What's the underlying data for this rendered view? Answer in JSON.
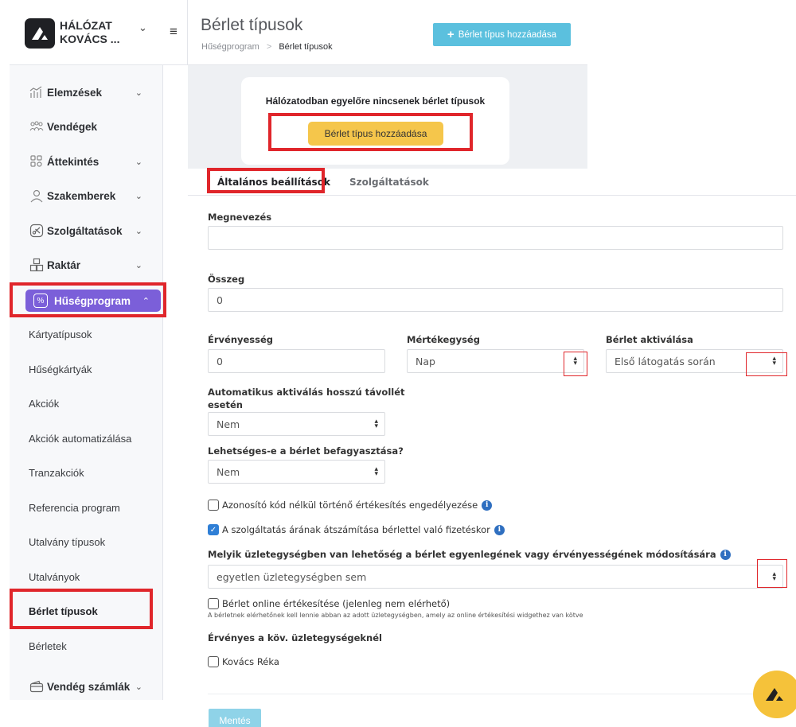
{
  "brand": {
    "line1": "HÁLÓZAT",
    "line2": "KOVÁCS ..."
  },
  "header": {
    "title": "Bérlet típusok",
    "breadcrumb_parent": "Hűségprogram",
    "breadcrumb_sep": ">",
    "breadcrumb_current": "Bérlet típusok",
    "add_button": "Bérlet típus hozzáadása"
  },
  "sidebar": {
    "main": [
      {
        "label": "Elemzések",
        "icon": "analytics-icon",
        "chevron": "⌄"
      },
      {
        "label": "Vendégek",
        "icon": "guests-icon",
        "chevron": ""
      },
      {
        "label": "Áttekintés",
        "icon": "overview-icon",
        "chevron": "⌄"
      },
      {
        "label": "Szakemberek",
        "icon": "person-icon",
        "chevron": "⌄"
      },
      {
        "label": "Szolgáltatások",
        "icon": "scissors-icon",
        "chevron": "⌄"
      },
      {
        "label": "Raktár",
        "icon": "warehouse-icon",
        "chevron": "⌄"
      }
    ],
    "active": {
      "label": "Hűségprogram",
      "icon": "percent-icon"
    },
    "sub": [
      "Kártyatípusok",
      "Hűségkártyák",
      "Akciók",
      "Akciók automatizálása",
      "Tranzakciók",
      "Referencia program",
      "Utalvány típusok",
      "Utalványok",
      "Bérlet típusok",
      "Bérletek"
    ],
    "bottom": {
      "label": "Vendég számlák",
      "icon": "wallet-icon"
    }
  },
  "empty_state": {
    "title": "Hálózatodban egyelőre nincsenek bérlet típusok",
    "button": "Bérlet típus hozzáadása"
  },
  "tabs": [
    "Általános beállítások",
    "Szolgáltatások"
  ],
  "form": {
    "name_label": "Megnevezés",
    "name_value": "",
    "amount_label": "Összeg",
    "amount_value": "0",
    "validity_label": "Érvényesség",
    "validity_value": "0",
    "unit_label": "Mértékegység",
    "unit_value": "Nap",
    "activation_label": "Bérlet aktiválása",
    "activation_value": "Első látogatás során",
    "auto_activation_label": "Automatikus aktiválás hosszú távollét esetén",
    "auto_activation_value": "Nem",
    "freeze_label": "Lehetséges-e a bérlet befagyasztása?",
    "freeze_value": "Nem",
    "check_no_code": "Azonosító kód nélkül történő értékesítés engedélyezése",
    "check_no_code_on": false,
    "check_convert": "A szolgáltatás árának átszámítása bérlettel való fizetéskor",
    "check_convert_on": true,
    "modify_label": "Melyik üzletegységben van lehetőség a bérlet egyenlegének vagy érvényességének módosítására",
    "modify_value": "egyetlen üzletegységben sem",
    "online_label": "Bérlet online értékesítése (jelenleg nem elérhető)",
    "online_on": false,
    "online_note": "A bérletnek elérhetőnek kell lennie abban az adott üzletegységben, amely az online értékesítési widgethez van kötve",
    "valid_units_label": "Érvényes a köv. üzletegységeknél",
    "unit_option": "Kovács Réka",
    "unit_option_on": false,
    "save": "Mentés"
  },
  "colors": {
    "accent_purple": "#7b5fd9",
    "highlight_red": "#e0262b",
    "info_blue": "#5bc0de",
    "yellow": "#f5c64b"
  }
}
